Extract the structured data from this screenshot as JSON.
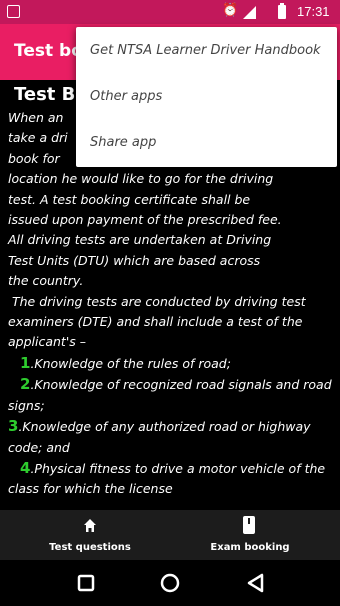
{
  "status_bar": {
    "time": "17:31"
  },
  "app_bar": {
    "title": "Test bo"
  },
  "content": {
    "heading": "Test Bo",
    "paragraph1_lines": [
      "When an",
      "take a dri",
      "book for",
      "location he would like to go for the driving",
      "test. A test booking certificate shall be",
      "issued upon payment of the prescribed fee.",
      "All driving tests are undertaken at Driving",
      "Test Units (DTU) which are based across",
      "the country."
    ],
    "paragraph2": "The driving tests are conducted by driving test examiners (DTE) and shall include a test of the applicant's –",
    "items": [
      {
        "num": "1",
        "text": ".Knowledge of the rules of road;"
      },
      {
        "num": "2",
        "text": ".Knowledge of recognized road signals and road signs;"
      },
      {
        "num": "3",
        "text": ".Knowledge of any authorized road or highway code; and"
      },
      {
        "num": "4",
        "text": ".Physical fitness to drive a motor vehicle of the class for which the license"
      }
    ]
  },
  "menu": {
    "items": [
      "Get NTSA Learner Driver Handbook",
      "Other apps",
      "Share app"
    ]
  },
  "bottom_nav": {
    "tabs": [
      {
        "label": "Test questions",
        "icon": "home-icon"
      },
      {
        "label": "Exam booking",
        "icon": "book-icon"
      }
    ]
  },
  "colors": {
    "status_bar": "#c2185b",
    "app_bar": "#e91e63",
    "number_accent": "#2ecc2e"
  }
}
